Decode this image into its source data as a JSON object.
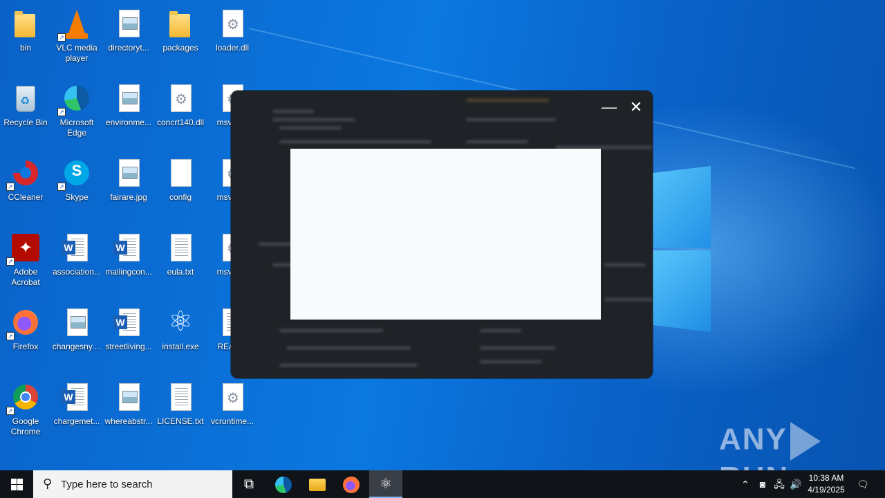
{
  "desktop": {
    "icons": [
      {
        "label": "bin",
        "icon": "folder-icon"
      },
      {
        "label": "VLC media player",
        "icon": "vlc-icon"
      },
      {
        "label": "directoryt...",
        "icon": "image-file-icon"
      },
      {
        "label": "packages",
        "icon": "folder-icon"
      },
      {
        "label": "loader.dll",
        "icon": "dll-file-icon"
      },
      {
        "label": "Recycle Bin",
        "icon": "recycle-bin-icon"
      },
      {
        "label": "Microsoft Edge",
        "icon": "edge-icon"
      },
      {
        "label": "environme...",
        "icon": "image-file-icon"
      },
      {
        "label": "concrt140.dll",
        "icon": "dll-file-icon"
      },
      {
        "label": "msvcp...",
        "icon": "dll-file-icon"
      },
      {
        "label": "CCleaner",
        "icon": "ccleaner-icon"
      },
      {
        "label": "Skype",
        "icon": "skype-icon"
      },
      {
        "label": "fairare.jpg",
        "icon": "image-file-icon"
      },
      {
        "label": "config",
        "icon": "blank-file-icon"
      },
      {
        "label": "msvcp...",
        "icon": "dll-file-icon"
      },
      {
        "label": "Adobe Acrobat",
        "icon": "acrobat-icon"
      },
      {
        "label": "association...",
        "icon": "word-doc-icon"
      },
      {
        "label": "mailingcon...",
        "icon": "word-doc-icon"
      },
      {
        "label": "eula.txt",
        "icon": "text-file-icon"
      },
      {
        "label": "msvcp...",
        "icon": "dll-file-icon"
      },
      {
        "label": "Firefox",
        "icon": "firefox-icon"
      },
      {
        "label": "changesny....",
        "icon": "image-file-icon"
      },
      {
        "label": "streetliving...",
        "icon": "word-doc-icon"
      },
      {
        "label": "install.exe",
        "icon": "atom-icon"
      },
      {
        "label": "READ...",
        "icon": "text-file-icon"
      },
      {
        "label": "Google Chrome",
        "icon": "chrome-icon"
      },
      {
        "label": "chargemet...",
        "icon": "word-doc-icon"
      },
      {
        "label": "whereabstr...",
        "icon": "image-file-icon"
      },
      {
        "label": "LICENSE.txt",
        "icon": "text-file-icon"
      },
      {
        "label": "vcruntime...",
        "icon": "dll-file-icon"
      }
    ]
  },
  "window": {
    "minimize_glyph": "—",
    "close_glyph": "✕"
  },
  "watermark": {
    "left": "ANY",
    "right": "RUN"
  },
  "taskbar": {
    "search_placeholder": "Type here to search",
    "time": "10:38 AM",
    "date": "4/19/2025"
  },
  "colors": {
    "desktop_blue": "#0b78e0",
    "taskbar": "#101419",
    "window_dark": "#1f2226"
  }
}
